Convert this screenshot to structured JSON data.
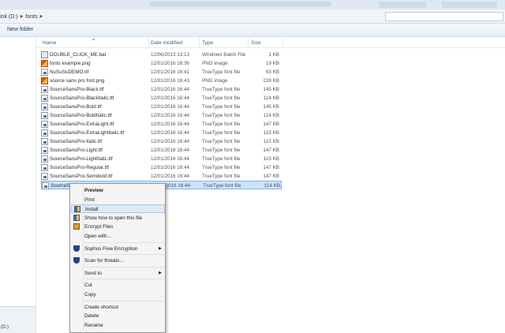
{
  "addressbar": {
    "crumbs": [
      "ink (D:)",
      "fonts"
    ]
  },
  "toolbar": {
    "new_folder": "New folder"
  },
  "navpane": {
    "drive_label": "(D:)"
  },
  "columns": {
    "name": "Name",
    "date": "Date modified",
    "type": "Type",
    "size": "Size"
  },
  "files": [
    {
      "name": "DOUBLE_CLICK_ME.bat",
      "date": "12/06/2013 13:13",
      "type": "Windows Batch File",
      "size": "1 KB",
      "icon": "bat-file-icon"
    },
    {
      "name": "fonts example.png",
      "date": "12/01/2016 16:36",
      "type": "PNG image",
      "size": "19 KB",
      "icon": "png-image-icon"
    },
    {
      "name": "NuSuSuDEMO.ttf",
      "date": "12/01/2016 16:41",
      "type": "TrueType font file",
      "size": "63 KB",
      "icon": "font-file-icon"
    },
    {
      "name": "source sans pro font.png",
      "date": "12/01/2016 16:43",
      "type": "PNG image",
      "size": "228 KB",
      "icon": "png-image-icon"
    },
    {
      "name": "SourceSansPro-Black.ttf",
      "date": "12/01/2016 16:44",
      "type": "TrueType font file",
      "size": "145 KB",
      "icon": "font-file-icon"
    },
    {
      "name": "SourceSansPro-BlackItalic.ttf",
      "date": "12/01/2016 16:44",
      "type": "TrueType font file",
      "size": "114 KB",
      "icon": "font-file-icon"
    },
    {
      "name": "SourceSansPro-Bold.ttf",
      "date": "12/01/2016 16:44",
      "type": "TrueType font file",
      "size": "145 KB",
      "icon": "font-file-icon"
    },
    {
      "name": "SourceSansPro-BoldItalic.ttf",
      "date": "12/01/2016 16:44",
      "type": "TrueType font file",
      "size": "114 KB",
      "icon": "font-file-icon"
    },
    {
      "name": "SourceSansPro-ExtraLight.ttf",
      "date": "12/01/2016 16:44",
      "type": "TrueType font file",
      "size": "147 KB",
      "icon": "font-file-icon"
    },
    {
      "name": "SourceSansPro-ExtraLightItalic.ttf",
      "date": "12/01/2016 16:44",
      "type": "TrueType font file",
      "size": "115 KB",
      "icon": "font-file-icon"
    },
    {
      "name": "SourceSansPro-Italic.ttf",
      "date": "12/01/2016 16:44",
      "type": "TrueType font file",
      "size": "115 KB",
      "icon": "font-file-icon"
    },
    {
      "name": "SourceSansPro-Light.ttf",
      "date": "12/01/2016 16:44",
      "type": "TrueType font file",
      "size": "147 KB",
      "icon": "font-file-icon"
    },
    {
      "name": "SourceSansPro-LightItalic.ttf",
      "date": "12/01/2016 16:44",
      "type": "TrueType font file",
      "size": "115 KB",
      "icon": "font-file-icon"
    },
    {
      "name": "SourceSansPro-Regular.ttf",
      "date": "12/01/2016 16:44",
      "type": "TrueType font file",
      "size": "147 KB",
      "icon": "font-file-icon"
    },
    {
      "name": "SourceSansPro-Semibold.ttf",
      "date": "12/01/2016 16:44",
      "type": "TrueType font file",
      "size": "147 KB",
      "icon": "font-file-icon"
    },
    {
      "name": "SourceSa",
      "date": "12/01/2016 16:44",
      "type": "TrueType font file",
      "size": "114 KB",
      "icon": "font-file-icon",
      "selected": true
    }
  ],
  "context_menu": {
    "items": [
      {
        "label": "Preview",
        "bold": true,
        "name": "menu-preview"
      },
      {
        "label": "Print",
        "name": "menu-print"
      },
      {
        "label": "Install",
        "name": "menu-install",
        "icon": "shield-icon",
        "hover": true
      },
      {
        "label": "Show how to open this file",
        "name": "menu-show-how-to-open",
        "icon": "shield-icon"
      },
      {
        "label": "Encrypt Files",
        "name": "menu-encrypt-files",
        "icon": "encrypt-icon"
      },
      {
        "label": "Open with...",
        "name": "menu-open-with"
      },
      {
        "sep": true
      },
      {
        "label": "Sophos Free Encryption",
        "name": "menu-sophos-encryption",
        "icon": "sophos-icon",
        "submenu": true
      },
      {
        "sep": true
      },
      {
        "label": "Scan for threats...",
        "name": "menu-scan-threats",
        "icon": "sophos-icon"
      },
      {
        "sep": true
      },
      {
        "label": "Send to",
        "name": "menu-send-to",
        "submenu": true
      },
      {
        "sep": true
      },
      {
        "label": "Cut",
        "name": "menu-cut"
      },
      {
        "label": "Copy",
        "name": "menu-copy"
      },
      {
        "sep": true
      },
      {
        "label": "Create shortcut",
        "name": "menu-create-shortcut"
      },
      {
        "label": "Delete",
        "name": "menu-delete"
      },
      {
        "label": "Rename",
        "name": "menu-rename"
      }
    ]
  }
}
